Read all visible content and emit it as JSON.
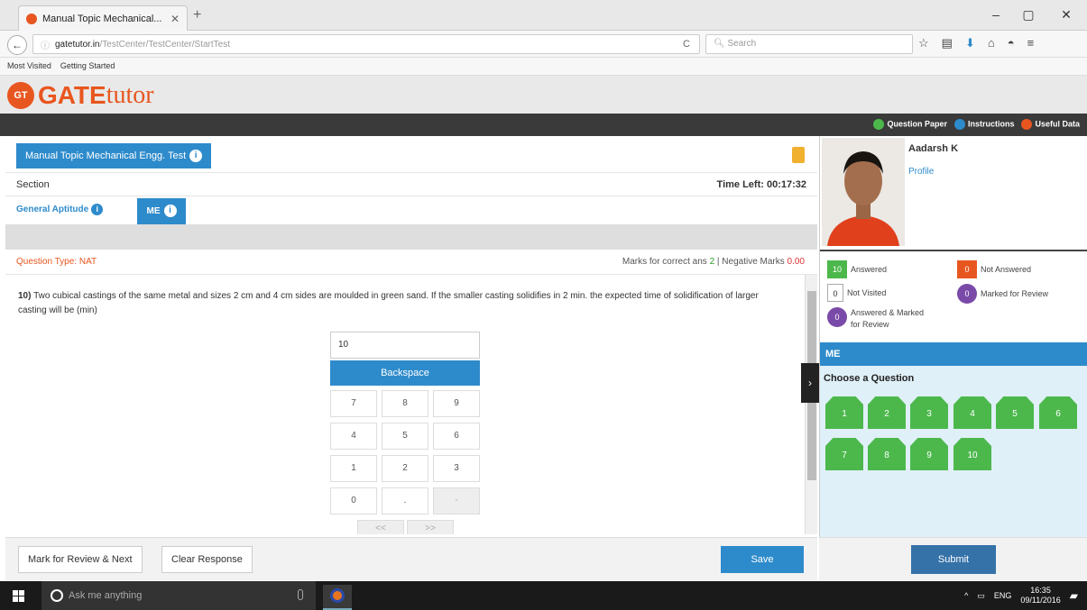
{
  "browser": {
    "tab_title": "Manual Topic Mechanical...",
    "tab_close": "✕",
    "new_tab": "+",
    "url_host": "gatetutor.in",
    "url_path": "/TestCenter/TestCenter/StartTest",
    "search_placeholder": "Search",
    "bookmarks": [
      "Most Visited",
      "Getting Started"
    ],
    "win_min": "–",
    "win_max": "▢",
    "win_close": "✕"
  },
  "site": {
    "logo_badge": "GT",
    "logo_gate": "GATE",
    "logo_tutor": "tutor",
    "links": [
      {
        "label": "Question Paper",
        "color": "#4cb84c"
      },
      {
        "label": "Instructions",
        "color": "#2e8bcb"
      },
      {
        "label": "Useful Data",
        "color": "#e8561f"
      }
    ]
  },
  "test": {
    "title": "Manual Topic Mechanical Engg. Test",
    "section_label": "Section",
    "time_left": "Time Left: 00:17:32",
    "sections": [
      "General Aptitude",
      "ME"
    ],
    "question_type_label": "Question Type:",
    "question_type": "NAT",
    "marks_correct_label": "Marks for correct ans",
    "marks_correct": "2",
    "negative_label": "| Negative Marks",
    "negative": "0.00"
  },
  "question": {
    "number": "10)",
    "text": "Two cubical castings of the same metal and sizes 2 cm and 4 cm sides are moulded in green sand. If the smaller casting solidifies in 2 min. the expected time of solidification of larger casting will be (min)",
    "answer_value": "10",
    "backspace_label": "Backspace",
    "keypad": [
      "7",
      "8",
      "9",
      "4",
      "5",
      "6",
      "1",
      "2",
      "3",
      "0",
      ".",
      "-"
    ],
    "nav_keys": [
      "<<",
      ">>"
    ]
  },
  "actions": {
    "mark_review": "Mark for Review & Next",
    "clear": "Clear Response",
    "save": "Save",
    "submit": "Submit"
  },
  "profile": {
    "name": "Aadarsh K",
    "link": "Profile"
  },
  "legend": {
    "answered_count": "10",
    "answered": "Answered",
    "not_answered_count": "0",
    "not_answered": "Not Answered",
    "not_visited_count": "0",
    "not_visited": "Not Visited",
    "marked_count": "0",
    "marked": "Marked for Review",
    "answered_marked_count": "0",
    "answered_marked_1": "Answered & Marked",
    "answered_marked_2": "for Review"
  },
  "palette": {
    "section": "ME",
    "choose": "Choose a Question",
    "questions": [
      "1",
      "2",
      "3",
      "4",
      "5",
      "6",
      "7",
      "8",
      "9",
      "10"
    ]
  },
  "taskbar": {
    "search": "Ask me anything",
    "lang": "ENG",
    "time": "16:35",
    "date": "09/11/2016"
  }
}
